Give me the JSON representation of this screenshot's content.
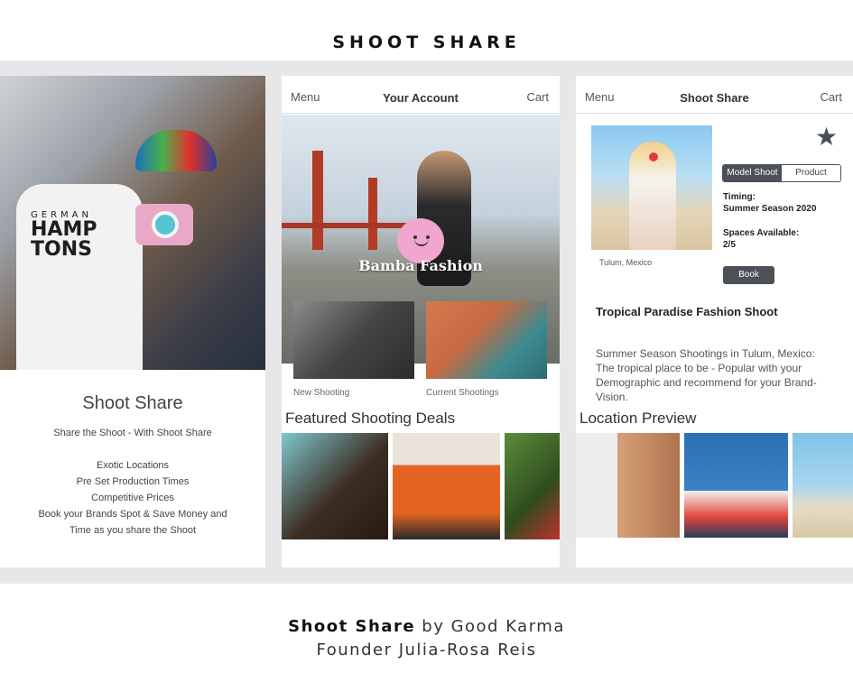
{
  "page": {
    "title": "SHOOT SHARE"
  },
  "panel1": {
    "shirt_line1": "GERMAN",
    "shirt_line2": "HAMP",
    "shirt_line3": "TONS",
    "heading": "Shoot Share",
    "tagline": "Share the Shoot - With Shoot Share",
    "features": [
      "Exotic Locations",
      "Pre Set Production Times",
      "Competitive Prices",
      "Book your Brands Spot & Save Money and",
      "Time as you share the Shoot"
    ]
  },
  "panel2": {
    "header": {
      "menu": "Menu",
      "title": "Your Account",
      "cart": "Cart"
    },
    "brand": "Bamba Fashion",
    "new_caption": "New Shooting",
    "current_caption": "Current Shootings",
    "deals_heading": "Featured Shooting Deals"
  },
  "panel3": {
    "header": {
      "menu": "Menu",
      "title": "Shoot Share",
      "cart": "Cart"
    },
    "location_caption": "Tulum, Mexico",
    "segment": {
      "active": "Model Shoot",
      "inactive": "Product"
    },
    "timing_label": "Timing:",
    "timing_value": "Summer Season 2020",
    "spaces_label": "Spaces Available:",
    "spaces_value": "2/5",
    "book_label": "Book",
    "shoot_title": "Tropical Paradise Fashion Shoot",
    "description": "Summer Season Shootings in Tulum, Mexico: The tropical place to be - Popular with your Demographic and recommend for your Brand-Vision.",
    "location_heading": "Location Preview"
  },
  "footer": {
    "product": "Shoot Share",
    "by": " by Good Karma",
    "founder": "Founder Julia-Rosa Reis"
  },
  "colors": {
    "accent_dark": "#4c5158",
    "band": "#e7e7e9",
    "logo_pink": "#f0a6cf"
  },
  "icons": [
    "star-icon"
  ]
}
